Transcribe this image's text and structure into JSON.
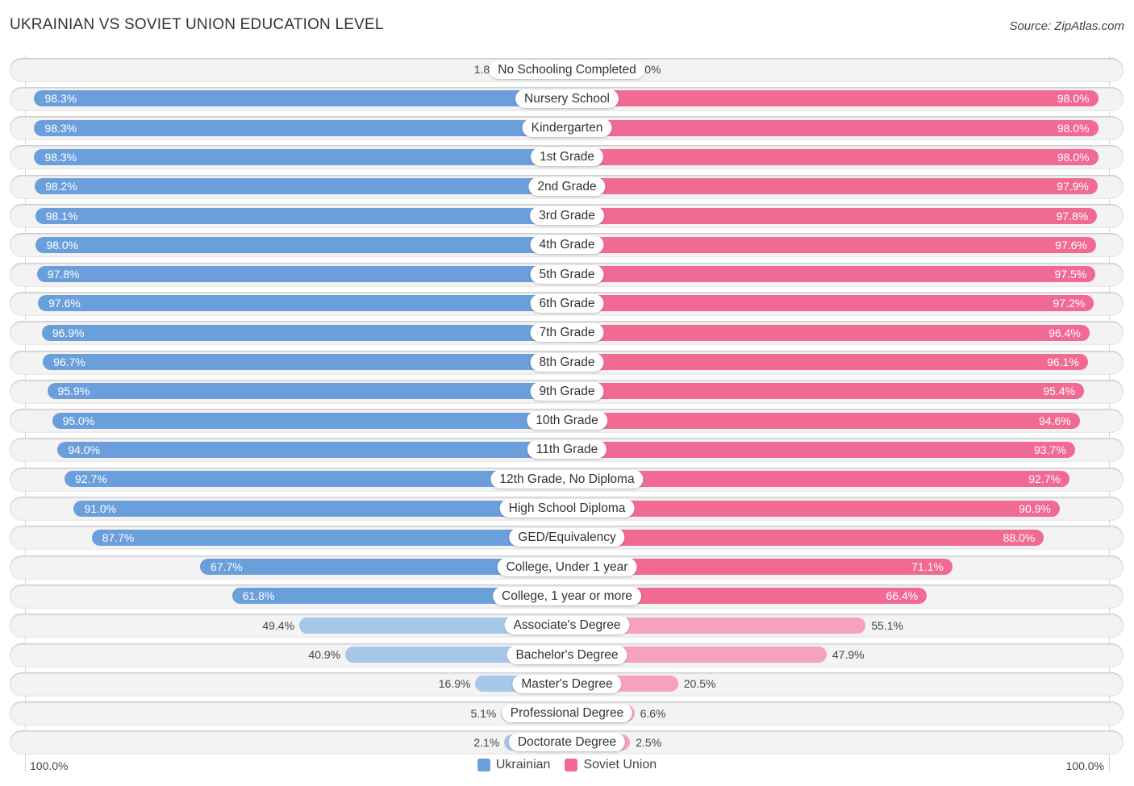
{
  "header": {
    "title": "UKRAINIAN VS SOVIET UNION EDUCATION LEVEL",
    "source": "Source: ZipAtlas.com"
  },
  "colors": {
    "ukrainian": "#6a9fdb",
    "ukrainian_light": "#a6c6ea",
    "soviet_union": "#f06a93",
    "soviet_union_light": "#f5a3bc"
  },
  "chart_data": {
    "type": "bar",
    "orientation": "horizontal-diverging",
    "title": "UKRAINIAN VS SOVIET UNION EDUCATION LEVEL",
    "categories": [
      "No Schooling Completed",
      "Nursery School",
      "Kindergarten",
      "1st Grade",
      "2nd Grade",
      "3rd Grade",
      "4th Grade",
      "5th Grade",
      "6th Grade",
      "7th Grade",
      "8th Grade",
      "9th Grade",
      "10th Grade",
      "11th Grade",
      "12th Grade, No Diploma",
      "High School Diploma",
      "GED/Equivalency",
      "College, Under 1 year",
      "College, 1 year or more",
      "Associate's Degree",
      "Bachelor's Degree",
      "Master's Degree",
      "Professional Degree",
      "Doctorate Degree"
    ],
    "series": [
      {
        "name": "Ukrainian",
        "side": "left",
        "values": [
          1.8,
          98.3,
          98.3,
          98.3,
          98.2,
          98.1,
          98.0,
          97.8,
          97.6,
          96.9,
          96.7,
          95.9,
          95.0,
          94.0,
          92.7,
          91.0,
          87.7,
          67.7,
          61.8,
          49.4,
          40.9,
          16.9,
          5.1,
          2.1
        ]
      },
      {
        "name": "Soviet Union",
        "side": "right",
        "values": [
          2.0,
          98.0,
          98.0,
          98.0,
          97.9,
          97.8,
          97.6,
          97.5,
          97.2,
          96.4,
          96.1,
          95.4,
          94.6,
          93.7,
          92.7,
          90.9,
          88.0,
          71.1,
          66.4,
          55.1,
          47.9,
          20.5,
          6.6,
          2.5
        ]
      }
    ],
    "value_format": "{v}%",
    "xlim": [
      0,
      100
    ],
    "axis_labels": {
      "left": "100.0%",
      "right": "100.0%"
    },
    "legend": {
      "placement": "bottom-center",
      "entries": [
        "Ukrainian",
        "Soviet Union"
      ]
    },
    "grid": false
  }
}
